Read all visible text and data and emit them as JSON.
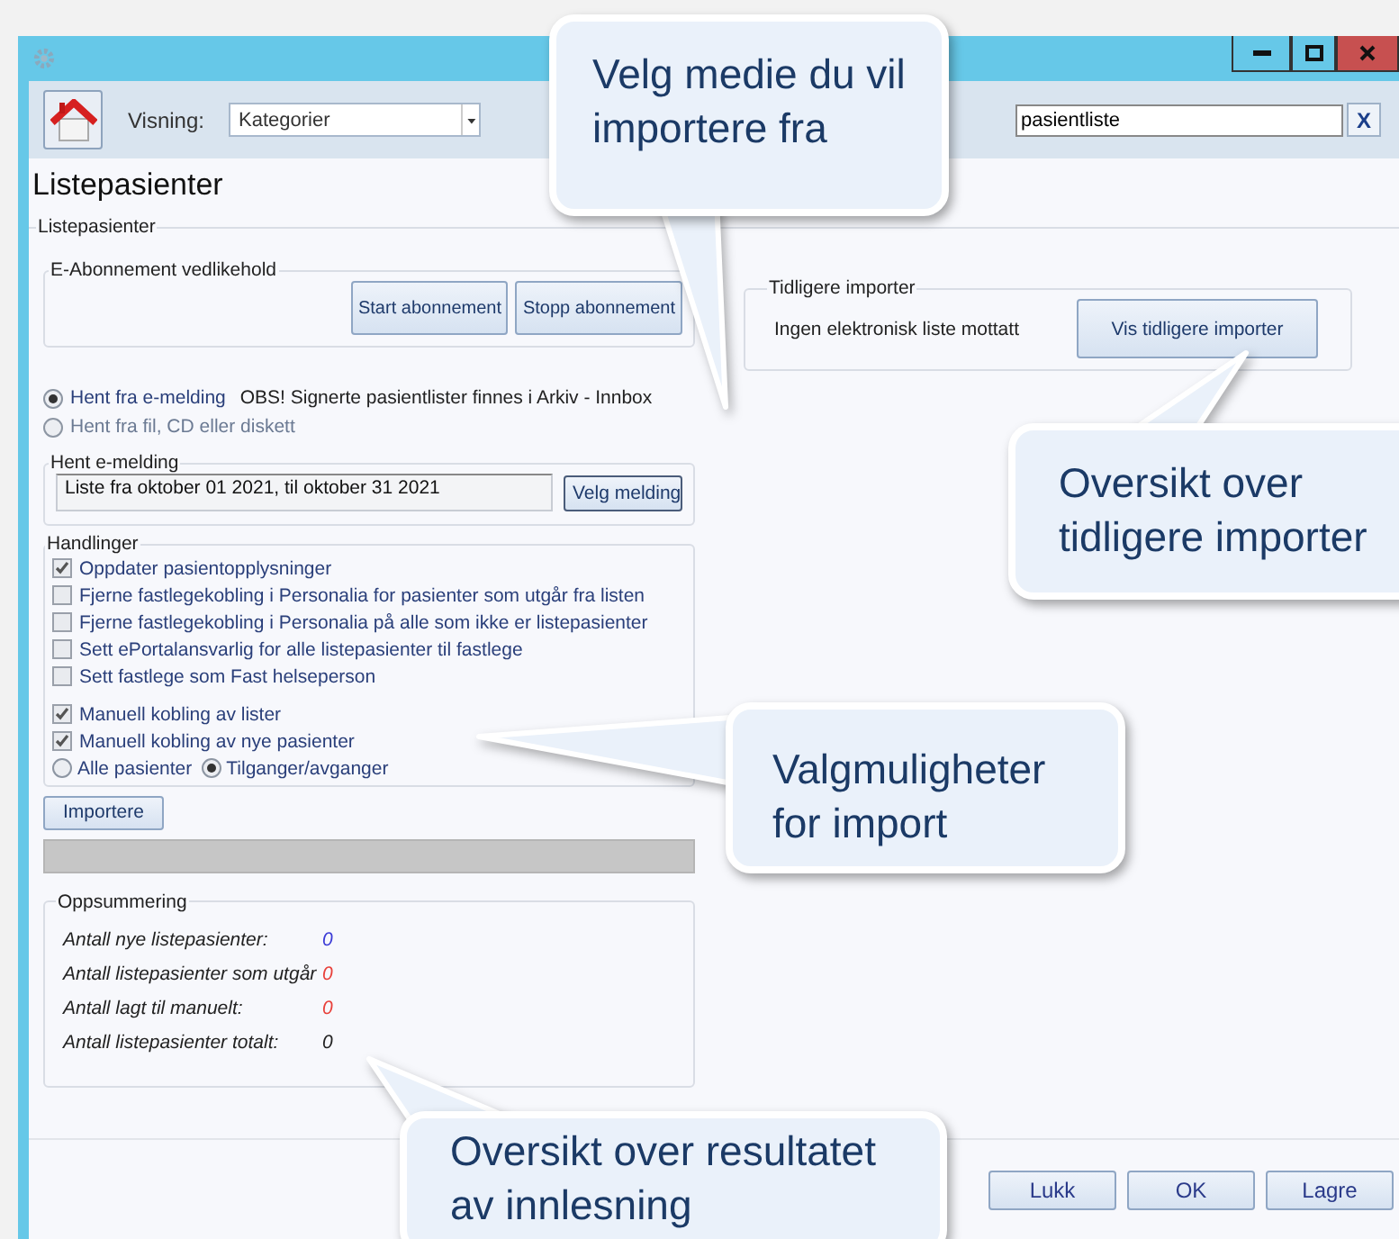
{
  "toolbar": {
    "view_label": "Visning:",
    "view_value": "Kategorier",
    "search_value": "pasientliste",
    "clear_label": "X"
  },
  "heading": "Listepasienter",
  "main_group": {
    "title": "Listepasienter"
  },
  "subscription": {
    "title": "E-Abonnement vedlikehold",
    "buttons": [
      "Start abonnement",
      "Stopp abonnement"
    ]
  },
  "sources": [
    {
      "label": "Hent fra e-melding",
      "selected": true,
      "disabled": false
    },
    {
      "label": "Hent fra fil, CD eller diskett",
      "selected": false,
      "disabled": true
    }
  ],
  "notice": "OBS! Signerte pasientlister finnes i Arkiv - Innbox",
  "fetch": {
    "title": "Hent e-melding",
    "value": "Liste fra oktober 01 2021, til oktober 31 2021",
    "button": "Velg melding"
  },
  "actions": {
    "title": "Handlinger",
    "options": [
      {
        "label": "Oppdater pasientopplysninger",
        "checked": true
      },
      {
        "label": "Fjerne fastlegekobling i Personalia for pasienter som utgår fra listen",
        "checked": false
      },
      {
        "label": "Fjerne fastlegekobling i Personalia på alle som ikke er listepasienter",
        "checked": false
      },
      {
        "label": "Sett ePortalansvarlig for alle listepasienter til fastlege",
        "checked": false
      },
      {
        "label": "Sett fastlege som Fast helseperson",
        "checked": false
      }
    ],
    "manual": [
      {
        "label": "Manuell kobling av lister",
        "checked": true
      },
      {
        "label": "Manuell kobling av nye pasienter",
        "checked": true
      }
    ],
    "scope": [
      {
        "label": "Alle pasienter",
        "selected": false
      },
      {
        "label": "Tilganger/avganger",
        "selected": true
      }
    ]
  },
  "import_button": "Importere",
  "summary": {
    "title": "Oppsummering",
    "rows": [
      {
        "label": "Antall nye listepasienter:",
        "value": "0",
        "color": "#3b3bd6"
      },
      {
        "label": "Antall listepasienter som utgår",
        "value": "0",
        "color": "#e8403a"
      },
      {
        "label": "Antall lagt til manuelt:",
        "value": "0",
        "color": "#e8403a"
      },
      {
        "label": "Antall listepasienter totalt:",
        "value": "0",
        "color": "#222222"
      }
    ]
  },
  "previous": {
    "title": "Tidligere importer",
    "status": "Ingen elektronisk liste mottatt",
    "button": "Vis tidligere importer"
  },
  "footer_buttons": [
    "Lukk",
    "OK",
    "Lagre"
  ],
  "callouts": [
    {
      "text": "Velg medie du vil importere fra"
    },
    {
      "text": "Oversikt over tidligere importer"
    },
    {
      "text": "Valgmuligheter for import"
    },
    {
      "text": "Oversikt over resultatet av innlesning"
    }
  ]
}
